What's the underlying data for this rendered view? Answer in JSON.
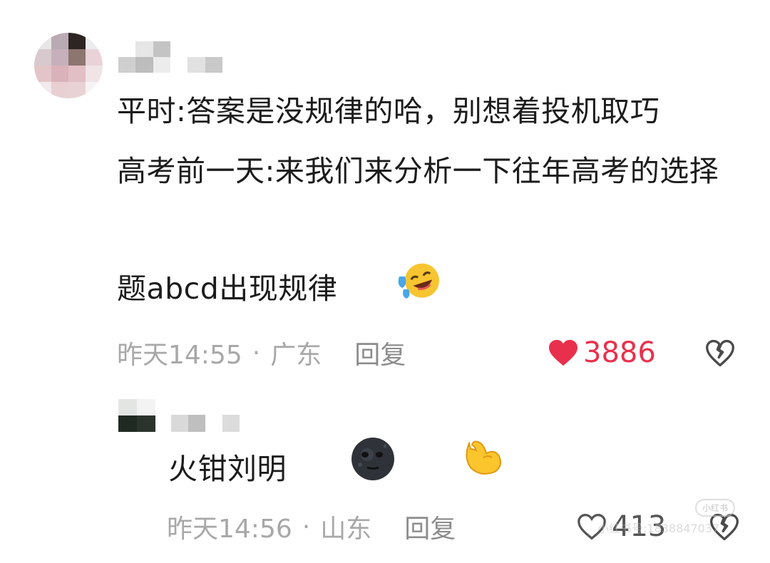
{
  "comment": {
    "text": "平时:答案是没规律的哈，别想着投机取巧\n高考前一天:来我们来分析一下往年高考的选择题abcd出现规律",
    "emoji": "laughing-crying-emoji",
    "time": "昨天14:55",
    "separator": "·",
    "location": "广东",
    "reply_label": "回复",
    "likes": "3886",
    "like_color": "#e8304c"
  },
  "reply": {
    "text": "火钳刘明",
    "emojis": [
      "new-moon-face-emoji",
      "flexed-biceps-emoji"
    ],
    "time": "昨天14:56",
    "separator": "·",
    "location": "山东",
    "reply_label": "回复",
    "likes": "413"
  },
  "watermark": {
    "logo": "小红书",
    "text": "小红书号:1838847037"
  }
}
